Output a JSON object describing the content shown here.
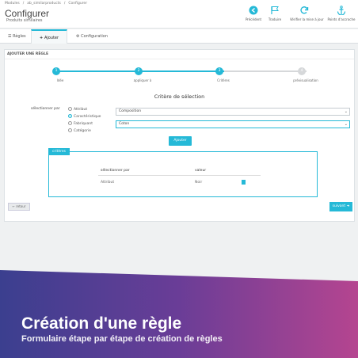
{
  "breadcrumb": [
    "Modules",
    "/",
    "ab_similarproducts",
    "/",
    "Configurer"
  ],
  "page": {
    "title": "Configurer",
    "subtitle": "Produits similaires"
  },
  "toolbar": [
    {
      "label": "Précédent",
      "icon": "arrow-left-circle-icon"
    },
    {
      "label": "Traduire",
      "icon": "flag-icon"
    },
    {
      "label": "Vérifier la mise à jour",
      "icon": "refresh-icon"
    },
    {
      "label": "Points d'accroche",
      "icon": "anchor-icon"
    }
  ],
  "tabs": [
    {
      "label": "Règles",
      "icon": "list-icon",
      "active": false
    },
    {
      "label": "Ajouter",
      "icon": "plus-icon",
      "active": true
    },
    {
      "label": "Configuration",
      "icon": "gears-icon",
      "active": false
    }
  ],
  "panel": {
    "heading": "AJOUTER UNE RÈGLE"
  },
  "steps": [
    {
      "num": "1",
      "label": "Idée",
      "done": true
    },
    {
      "num": "2",
      "label": "appliquer à",
      "done": true
    },
    {
      "num": "3",
      "label": "Critères",
      "done": true
    },
    {
      "num": "4",
      "label": "prévisualisation",
      "done": false
    }
  ],
  "criteria_form": {
    "title": "Critère de sélection",
    "select_by_label": "sélectionner par",
    "options": [
      {
        "label": "Attribut",
        "checked": false
      },
      {
        "label": "Caractéristique",
        "checked": true
      },
      {
        "label": "Fabriquant",
        "checked": false
      },
      {
        "label": "Catégorie",
        "checked": false
      }
    ],
    "select1_value": "Composition",
    "select2_value": "Coton",
    "add_button": "Ajouter"
  },
  "criteria_table": {
    "tag": "critères",
    "headers": [
      "sélectionner par",
      "valeur"
    ],
    "rows": [
      {
        "by": "Attribut",
        "value": "Noir"
      }
    ]
  },
  "nav": {
    "back": "retour",
    "next": "suivant"
  },
  "banner": {
    "title": "Création d'une règle",
    "subtitle": "Formulaire étape par étape de création de règles"
  },
  "colors": {
    "accent": "#25b9d7",
    "banner_start": "#3b3f8f",
    "banner_end": "#b54590"
  }
}
